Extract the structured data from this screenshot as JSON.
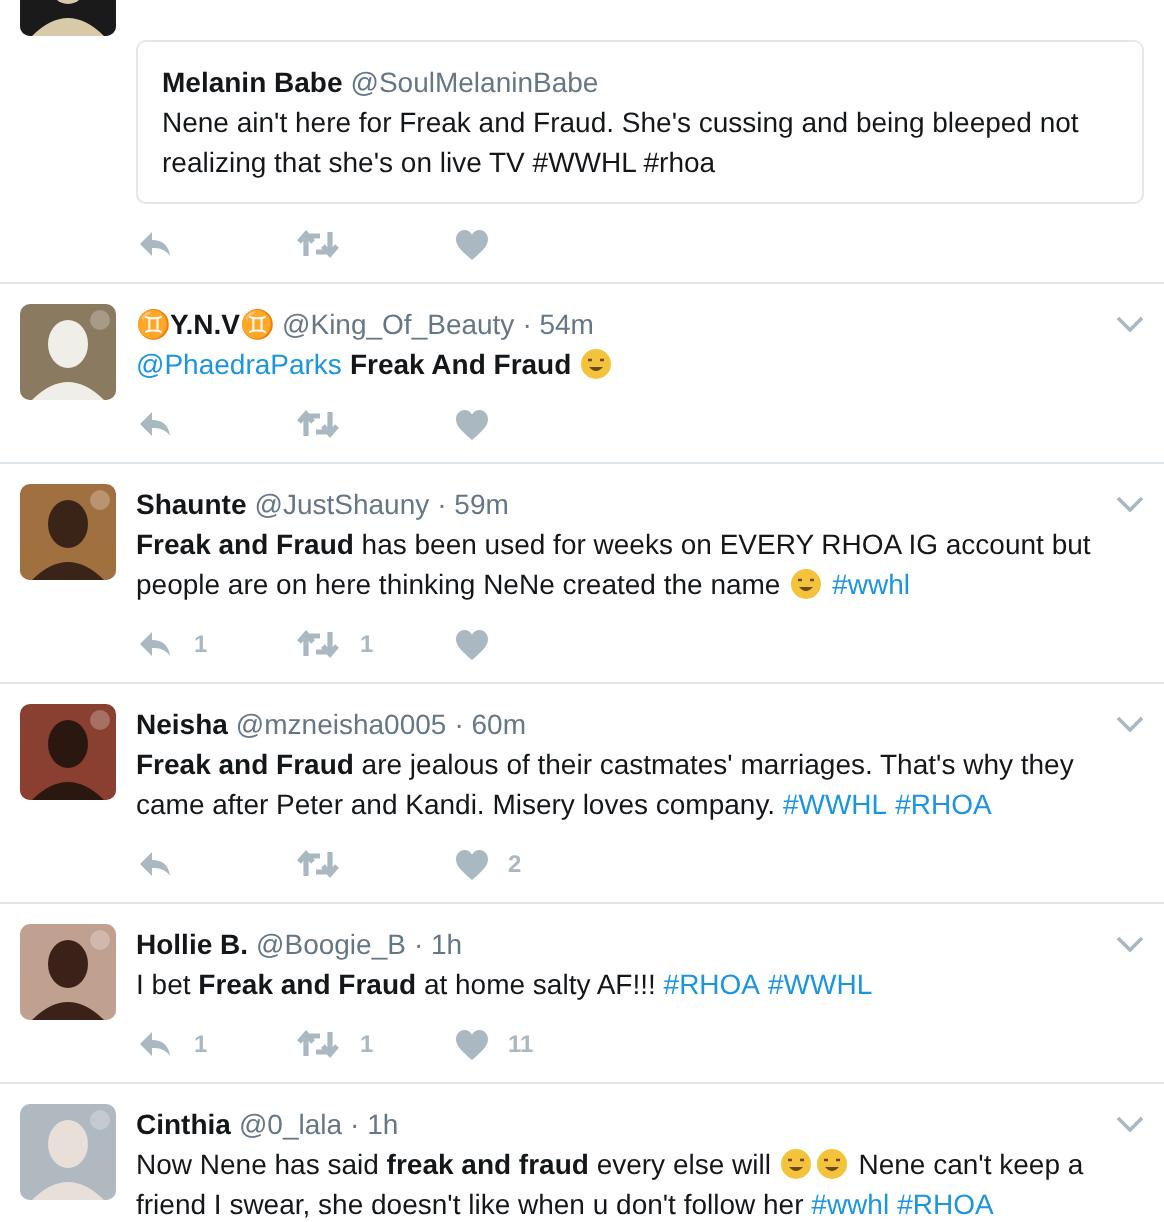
{
  "tweets": [
    {
      "quote": {
        "name": "Melanin Babe",
        "handle": "@SoulMelaninBabe",
        "text": "Nene ain't here for Freak and Fraud. She's cussing and being bleeped not realizing that she's on live TV #WWHL #rhoa"
      }
    },
    {
      "name": "♊Y.N.V♊",
      "handle": "@King_Of_Beauty",
      "time": "· 54m",
      "body": [
        {
          "kind": "link",
          "text": "@PhaedraParks"
        },
        {
          "kind": "bold",
          "text": "Freak And Fraud"
        },
        {
          "kind": "emoji"
        }
      ]
    },
    {
      "name": "Shaunte",
      "handle": "@JustShauny",
      "time": "· 59m",
      "body": [
        {
          "kind": "bold",
          "text": "Freak and Fraud"
        },
        {
          "kind": "text",
          "text": " has been used for weeks on EVERY RHOA IG account but people are on here thinking NeNe created the name "
        },
        {
          "kind": "emoji"
        },
        {
          "kind": "link",
          "text": "#wwhl"
        }
      ],
      "actions": {
        "replies": "1",
        "retweets": "1"
      }
    },
    {
      "name": "Neisha",
      "handle": "@mzneisha0005",
      "time": "· 60m",
      "body": [
        {
          "kind": "bold",
          "text": "Freak and Fraud"
        },
        {
          "kind": "text",
          "text": " are jealous of their castmates' marriages.  That's why they came after Peter and Kandi. Misery loves company. "
        },
        {
          "kind": "link",
          "text": "#WWHL"
        },
        {
          "kind": "link",
          "text": "#RHOA"
        }
      ],
      "actions": {
        "likes": "2"
      }
    },
    {
      "name": "Hollie B.",
      "handle": "@Boogie_B",
      "time": "· 1h",
      "body": [
        {
          "kind": "text",
          "text": "I bet "
        },
        {
          "kind": "bold",
          "text": "Freak and Fraud"
        },
        {
          "kind": "text",
          "text": " at home salty AF!!! "
        },
        {
          "kind": "link",
          "text": "#RHOA"
        },
        {
          "kind": "link",
          "text": "#WWHL"
        }
      ],
      "actions": {
        "replies": "1",
        "retweets": "1",
        "likes": "11"
      }
    },
    {
      "name": "Cinthia",
      "handle": "@0_lala",
      "time": "· 1h",
      "body": [
        {
          "kind": "text",
          "text": "Now Nene has said "
        },
        {
          "kind": "bold",
          "text": "freak and fraud"
        },
        {
          "kind": "text",
          "text": " every else will "
        },
        {
          "kind": "emoji"
        },
        {
          "kind": "emoji"
        },
        {
          "kind": "text",
          "text": " Nene can't keep a friend I swear, she doesn't like when u don't follow her "
        },
        {
          "kind": "link",
          "text": "#wwhl"
        },
        {
          "kind": "link",
          "text": "#RHOA"
        }
      ]
    }
  ]
}
